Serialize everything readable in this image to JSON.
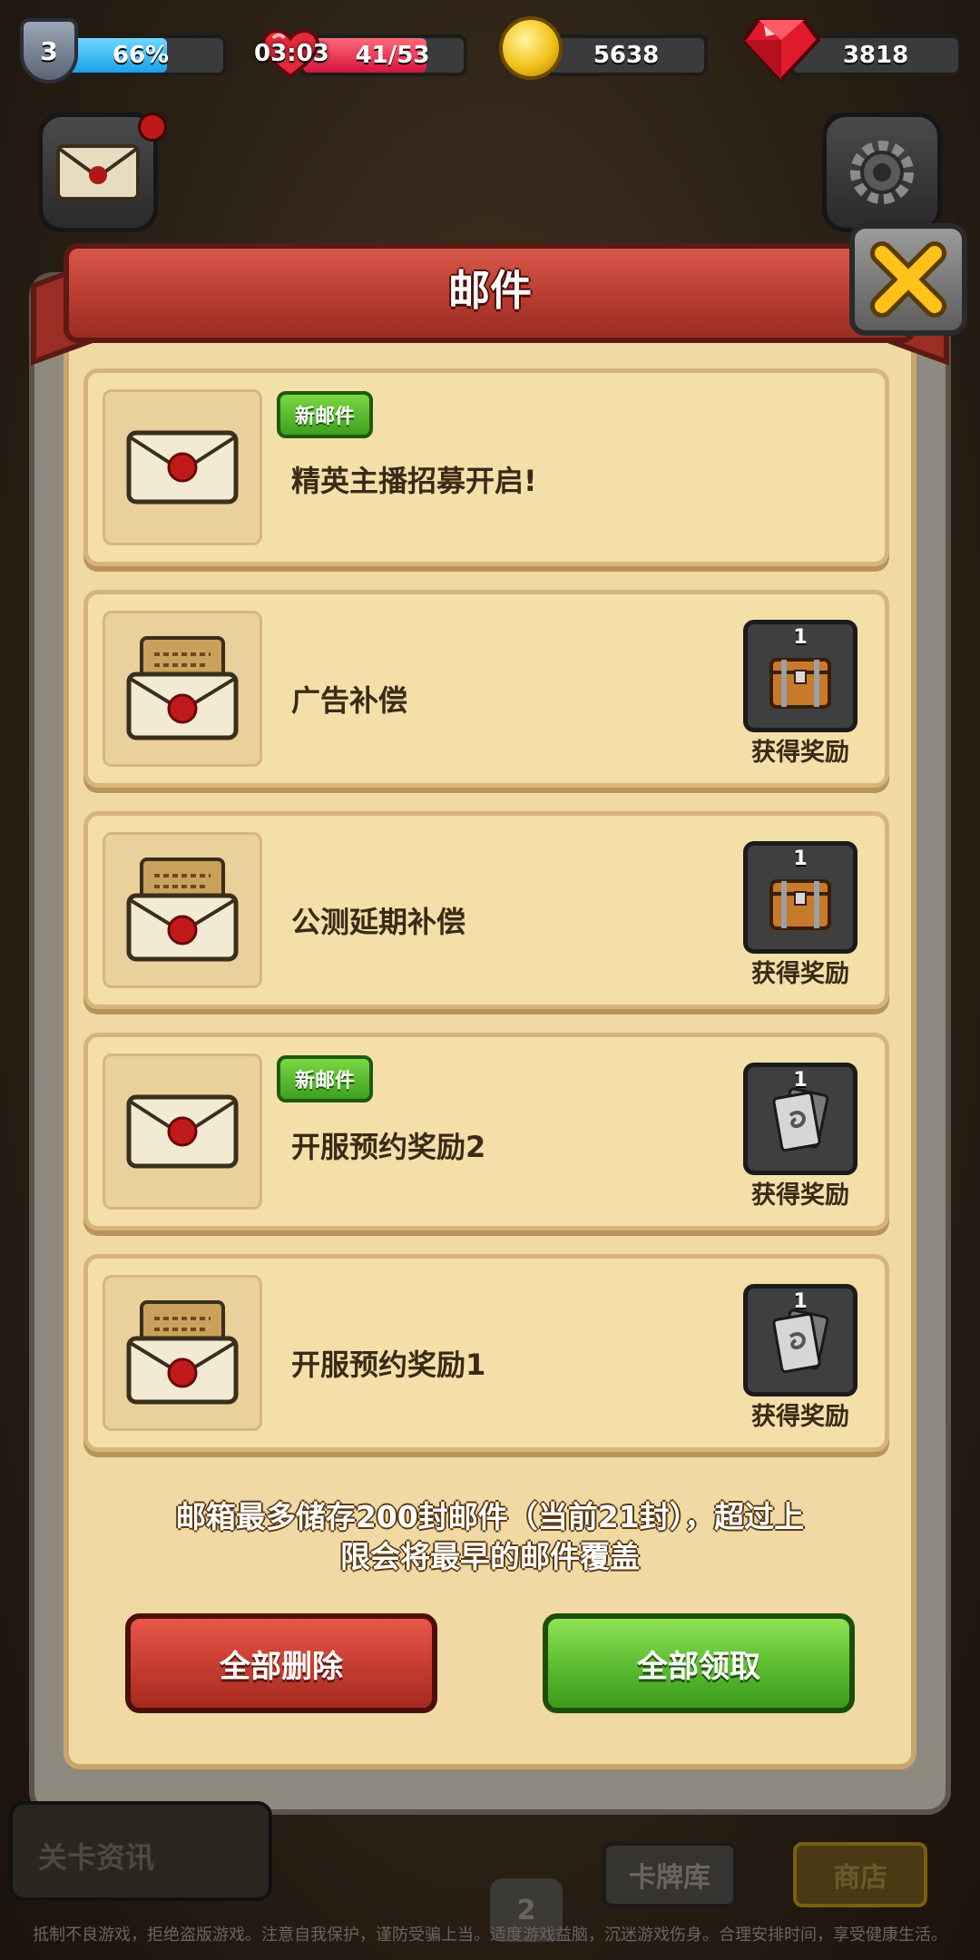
{
  "hud": {
    "level": "3",
    "xp_percent": "66%",
    "xp_fill": 0.66,
    "timer": "03:03",
    "stamina": "41/53",
    "stamina_fill": 0.77,
    "coins": "5638",
    "gems": "3818"
  },
  "dialog": {
    "title": "邮件",
    "mails": [
      {
        "badge": "新邮件",
        "title": "精英主播招募开启!",
        "envelope": "sealed-envelope-icon",
        "reward": null
      },
      {
        "badge": "",
        "title": "广告补偿",
        "envelope": "open-letter-envelope-icon",
        "reward": {
          "count": "1",
          "icon": "treasure-chest-icon",
          "label": "获得奖励"
        }
      },
      {
        "badge": "",
        "title": "公测延期补偿",
        "envelope": "open-letter-envelope-icon",
        "reward": {
          "count": "1",
          "icon": "treasure-chest-icon",
          "label": "获得奖励"
        }
      },
      {
        "badge": "新邮件",
        "title": "开服预约奖励2",
        "envelope": "sealed-envelope-icon",
        "reward": {
          "count": "1",
          "icon": "card-icon",
          "label": "获得奖励"
        }
      },
      {
        "badge": "",
        "title": "开服预约奖励1",
        "envelope": "open-letter-envelope-icon",
        "reward": {
          "count": "1",
          "icon": "card-icon",
          "label": "获得奖励"
        }
      }
    ],
    "info_line1": "邮箱最多储存200封邮件（当前21封），超过上",
    "info_line2": "限会将最早的邮件覆盖",
    "delete_all": "全部删除",
    "claim_all": "全部领取"
  },
  "bottom": {
    "stage_info": "关卡资讯",
    "cards_tab": "卡牌库",
    "shop_tab": "商店",
    "bottom_number": "2"
  },
  "footer": "抵制不良游戏，拒绝盗版游戏。注意自我保护，谨防受骗上当。适度游戏益脑，沉迷游戏伤身。合理安排时间，享受健康生活。"
}
